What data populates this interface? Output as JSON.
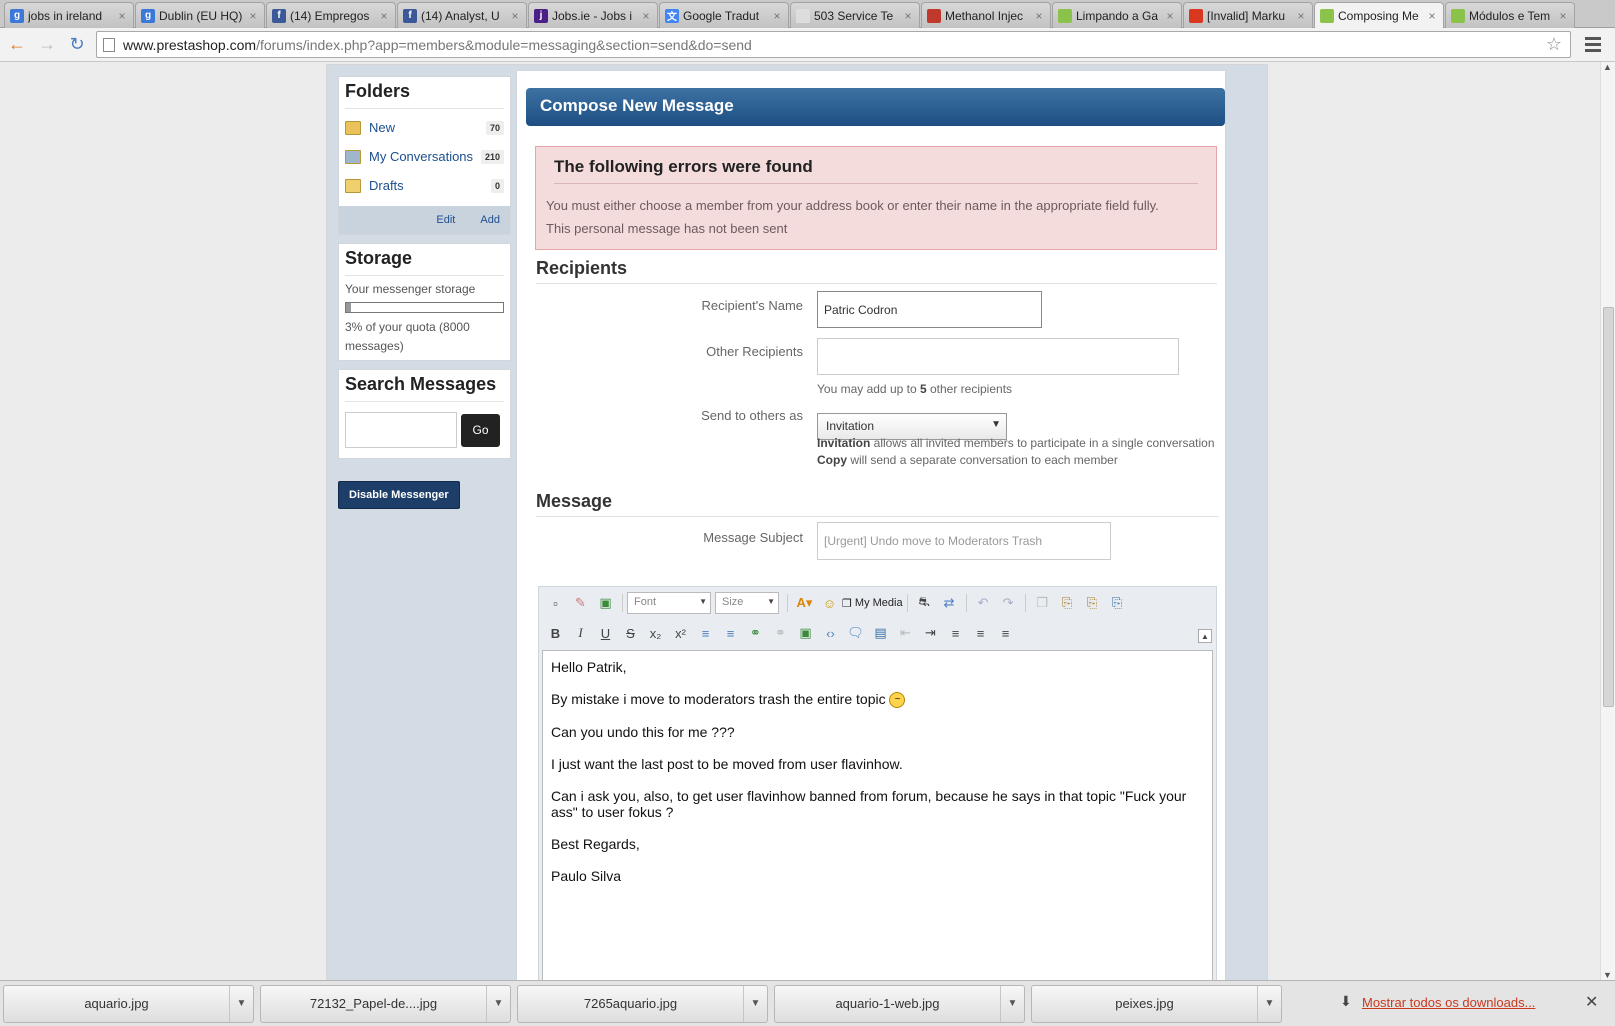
{
  "tabs": [
    {
      "title": "jobs in ireland",
      "icon": "google-icon",
      "color": "#3c78d8",
      "glyph": "g",
      "active": false
    },
    {
      "title": "Dublin (EU HQ)",
      "icon": "google-icon",
      "color": "#3c78d8",
      "glyph": "g",
      "active": false
    },
    {
      "title": "(14) Empregos",
      "icon": "facebook-icon",
      "color": "#3b5998",
      "glyph": "f",
      "active": false
    },
    {
      "title": "(14) Analyst, U",
      "icon": "facebook-icon",
      "color": "#3b5998",
      "glyph": "f",
      "active": false
    },
    {
      "title": "Jobs.ie - Jobs i",
      "icon": "jobsie-icon",
      "color": "#4a1f87",
      "glyph": "j",
      "active": false
    },
    {
      "title": "Google Tradut",
      "icon": "translate-icon",
      "color": "#4285f4",
      "glyph": "文",
      "active": false
    },
    {
      "title": "503 Service Te",
      "icon": "page-icon",
      "color": "#dddddd",
      "glyph": "",
      "active": false
    },
    {
      "title": "Methanol Injec",
      "icon": "methanol-icon",
      "color": "#c0392b",
      "glyph": "",
      "active": false
    },
    {
      "title": "Limpando a Ga",
      "icon": "prestashop-icon",
      "color": "#8bc34a",
      "glyph": "",
      "active": false
    },
    {
      "title": "[Invalid] Marku",
      "icon": "invalid-icon",
      "color": "#d9381e",
      "glyph": "",
      "active": false
    },
    {
      "title": "Composing Me",
      "icon": "prestashop-icon",
      "color": "#8bc34a",
      "glyph": "",
      "active": true
    },
    {
      "title": "Módulos e Tem",
      "icon": "prestashop-icon",
      "color": "#8bc34a",
      "glyph": "",
      "active": false
    }
  ],
  "url": {
    "domain": "www.prestashop.com",
    "path": "/forums/index.php?app=members&module=messaging&section=send&do=send"
  },
  "sidebar": {
    "folders_title": "Folders",
    "folders": [
      {
        "label": "New",
        "count": "70",
        "icon": "new-folder-icon",
        "color": "#e8c35a"
      },
      {
        "label": "My Conversations",
        "count": "210",
        "icon": "envelope-icon",
        "color": "#9fb6cc"
      },
      {
        "label": "Drafts",
        "count": "0",
        "icon": "drafts-folder-icon",
        "color": "#f0cf6e"
      }
    ],
    "edit_label": "Edit",
    "add_label": "Add",
    "storage_title": "Storage",
    "storage_text": "Your messenger storage",
    "quota_percent": 3,
    "quota_text": "3% of your quota (8000 messages)",
    "search_title": "Search Messages",
    "go_label": "Go",
    "disable_label": "Disable Messenger"
  },
  "compose": {
    "header": "Compose New Message",
    "error_title": "The following errors were found",
    "errors": [
      "You must either choose a member from your address book or enter their name in the appropriate field fully.",
      "This personal message has not been sent"
    ],
    "recipients_title": "Recipients",
    "recipient_name_label": "Recipient's Name",
    "recipient_name_value": "Patric Codron",
    "other_recipients_label": "Other Recipients",
    "other_hint_pre": "You may add up to ",
    "other_hint_num": "5",
    "other_hint_post": " other recipients",
    "send_label": "Send to others as",
    "send_value": "Invitation",
    "inv_b": "Invitation",
    "inv_text": " allows all invited members to participate in a single conversation",
    "copy_b": "Copy",
    "copy_text": " will send a separate conversation to each member",
    "message_title": "Message",
    "subject_label": "Message Subject",
    "subject_value": "[Urgent] Undo move to Moderators Trash",
    "font_label": "Font",
    "size_label": "Size",
    "mymedia_label": "My Media",
    "body": [
      "Hello Patrik,",
      "By mistake i move to moderators trash the entire topic",
      "Can you undo this for me ???",
      "I just want the last post to be moved from user flavinhow.",
      "Can i ask you, also, to get user flavinhow banned from forum, because he says in that topic \"Fuck your ass\" to user fokus ?",
      "Best Regards,",
      "Paulo Silva"
    ]
  },
  "downloads": [
    "aquario.jpg",
    "72132_Papel-de....jpg",
    "7265aquario.jpg",
    "aquario-1-web.jpg",
    "peixes.jpg"
  ],
  "show_all": "Mostrar todos os downloads..."
}
